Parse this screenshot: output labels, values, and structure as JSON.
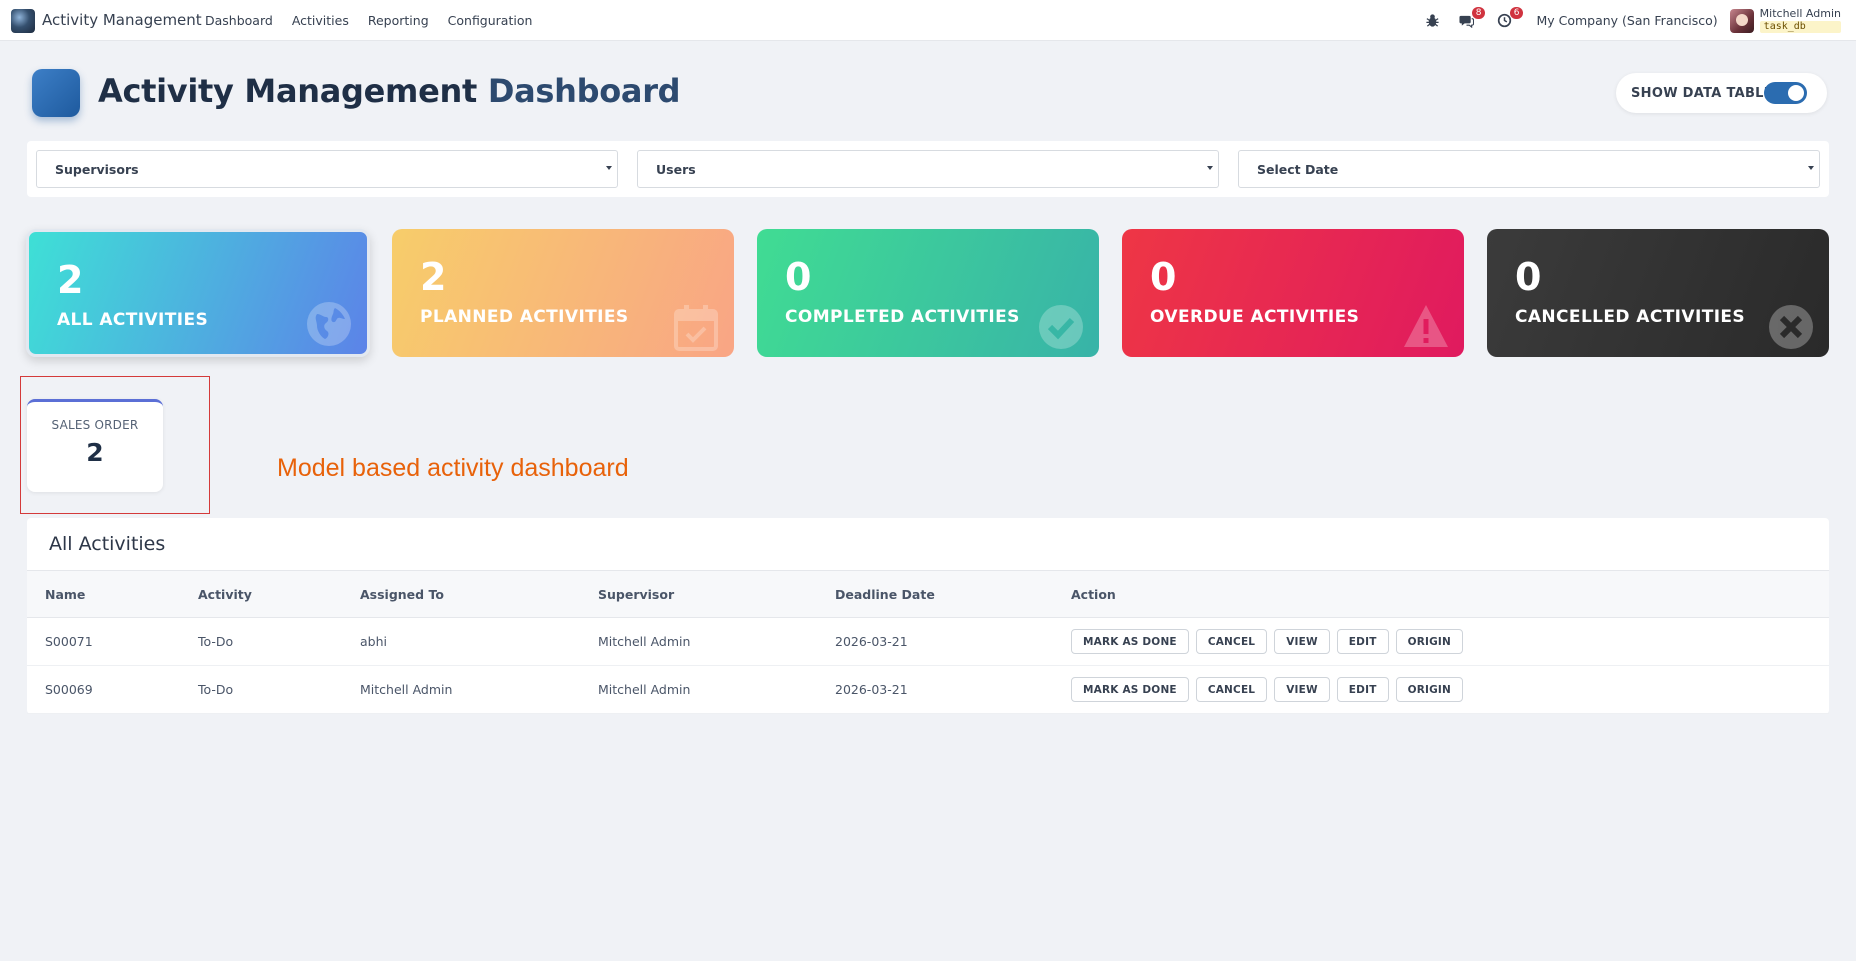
{
  "navbar": {
    "brand": "Activity Management",
    "menu": [
      "Dashboard",
      "Activities",
      "Reporting",
      "Configuration"
    ],
    "messages_badge": "8",
    "activities_badge": "6",
    "company": "My Company (San Francisco)",
    "user_name": "Mitchell Admin",
    "db_name": "task_db"
  },
  "header": {
    "title_main": "Activity Management",
    "title_accent": "Dashboard",
    "toggle_label": "SHOW DATA TABLE",
    "toggle_on": true
  },
  "filters": {
    "supervisors": "Supervisors",
    "users": "Users",
    "date": "Select Date"
  },
  "stats": [
    {
      "value": "2",
      "label": "ALL ACTIVITIES",
      "icon": "globe-icon",
      "from": "#3ee0d6",
      "to": "#5c83e8"
    },
    {
      "value": "2",
      "label": "PLANNED ACTIVITIES",
      "icon": "calendar-check-icon",
      "from": "#f7cd6a",
      "to": "#f9a585"
    },
    {
      "value": "0",
      "label": "COMPLETED ACTIVITIES",
      "icon": "check-circle-icon",
      "from": "#40dc93",
      "to": "#38b3a8"
    },
    {
      "value": "0",
      "label": "OVERDUE ACTIVITIES",
      "icon": "warning-icon",
      "from": "#ee3645",
      "to": "#e01a5f"
    },
    {
      "value": "0",
      "label": "CANCELLED ACTIVITIES",
      "icon": "close-circle-icon",
      "from": "#3b3b3b",
      "to": "#2a2a2a"
    }
  ],
  "model_card": {
    "name": "SALES ORDER",
    "count": "2"
  },
  "annotation": "Model based activity dashboard",
  "table": {
    "title": "All Activities",
    "columns": [
      "Name",
      "Activity",
      "Assigned To",
      "Supervisor",
      "Deadline Date",
      "Action"
    ],
    "rows": [
      {
        "name": "S00071",
        "activity": "To-Do",
        "assigned": "abhi",
        "supervisor": "Mitchell Admin",
        "deadline": "2026-03-21"
      },
      {
        "name": "S00069",
        "activity": "To-Do",
        "assigned": "Mitchell Admin",
        "supervisor": "Mitchell Admin",
        "deadline": "2026-03-21"
      }
    ],
    "actions": [
      "MARK AS DONE",
      "CANCEL",
      "VIEW",
      "EDIT",
      "ORIGIN"
    ]
  }
}
